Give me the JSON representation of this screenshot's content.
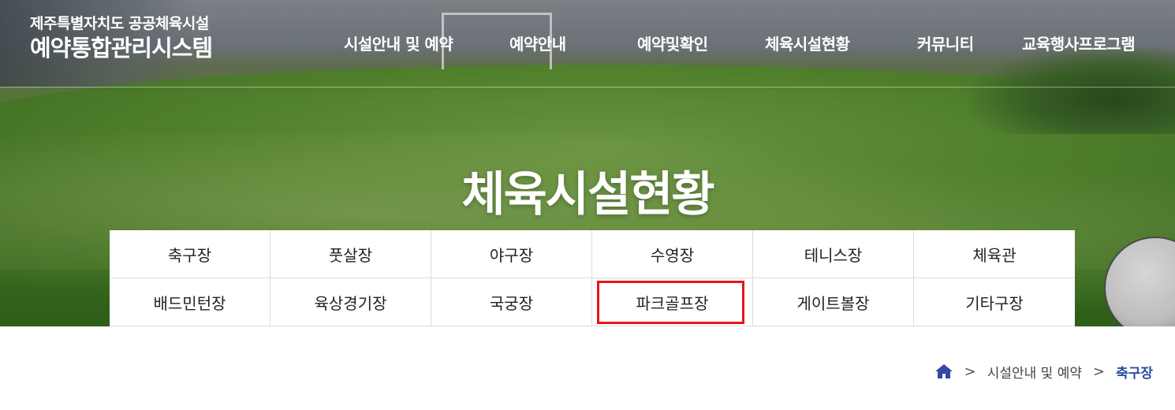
{
  "header": {
    "logo_sub": "제주특별자치도 공공체육시설",
    "logo_main": "예약통합관리시스템"
  },
  "nav": [
    {
      "label": "시설안내 및 예약"
    },
    {
      "label": "예약안내"
    },
    {
      "label": "예약및확인"
    },
    {
      "label": "체육시설현황"
    },
    {
      "label": "커뮤니티"
    },
    {
      "label": "교육행사프로그램"
    }
  ],
  "hero": {
    "title": "체육시설현황"
  },
  "facilities": [
    {
      "label": "축구장"
    },
    {
      "label": "풋살장"
    },
    {
      "label": "야구장"
    },
    {
      "label": "수영장"
    },
    {
      "label": "테니스장"
    },
    {
      "label": "체육관"
    },
    {
      "label": "배드민턴장"
    },
    {
      "label": "육상경기장"
    },
    {
      "label": "국궁장"
    },
    {
      "label": "파크골프장"
    },
    {
      "label": "게이트볼장"
    },
    {
      "label": "기타구장"
    }
  ],
  "highlighted_facility": "파크골프장",
  "breadcrumb": {
    "home_icon": "home-icon",
    "separator": ">",
    "items": [
      {
        "label": "시설안내 및 예약"
      },
      {
        "label": "축구장"
      }
    ]
  },
  "colors": {
    "highlight_border": "#e8141a",
    "breadcrumb_current": "#2f4da0"
  }
}
